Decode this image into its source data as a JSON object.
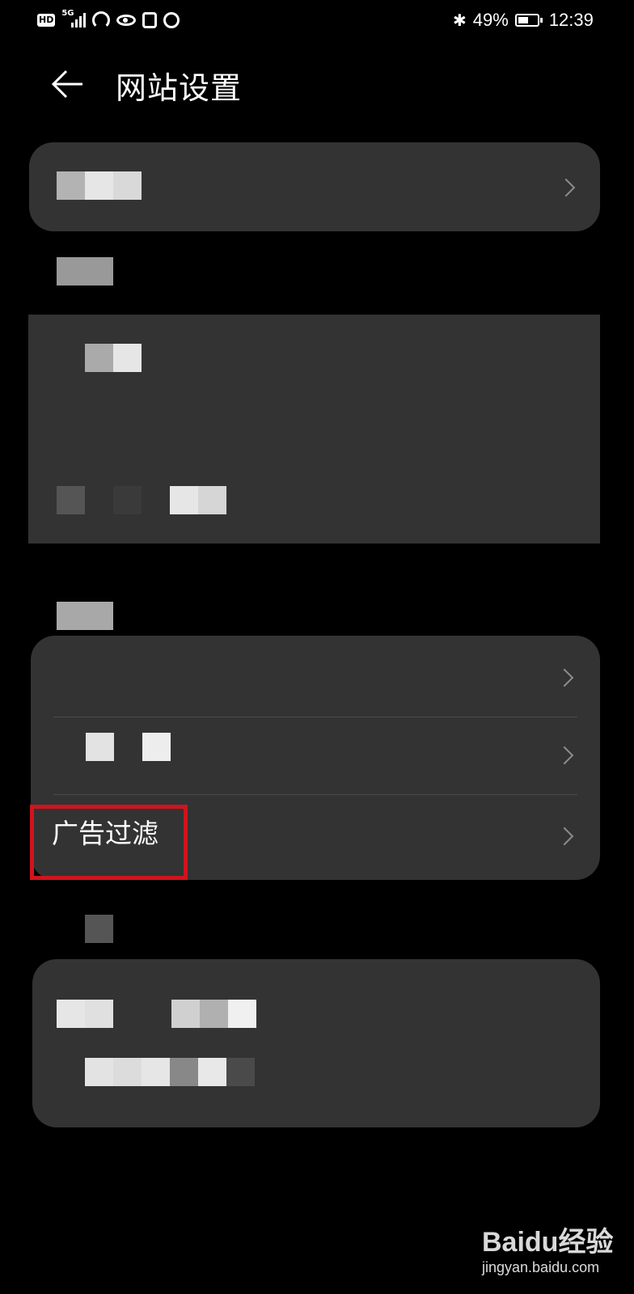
{
  "status_bar": {
    "hd_label": "HD",
    "network": "5G",
    "battery": "49%",
    "time": "12:39"
  },
  "header": {
    "title": "网站设置"
  },
  "section_advanced": {
    "ad_filter_label": "广告过滤"
  },
  "watermark": {
    "brand": "Baidu经验",
    "url": "jingyan.baidu.com"
  },
  "colors": {
    "background": "#000000",
    "card": "#333333",
    "highlight": "#d0141d"
  }
}
